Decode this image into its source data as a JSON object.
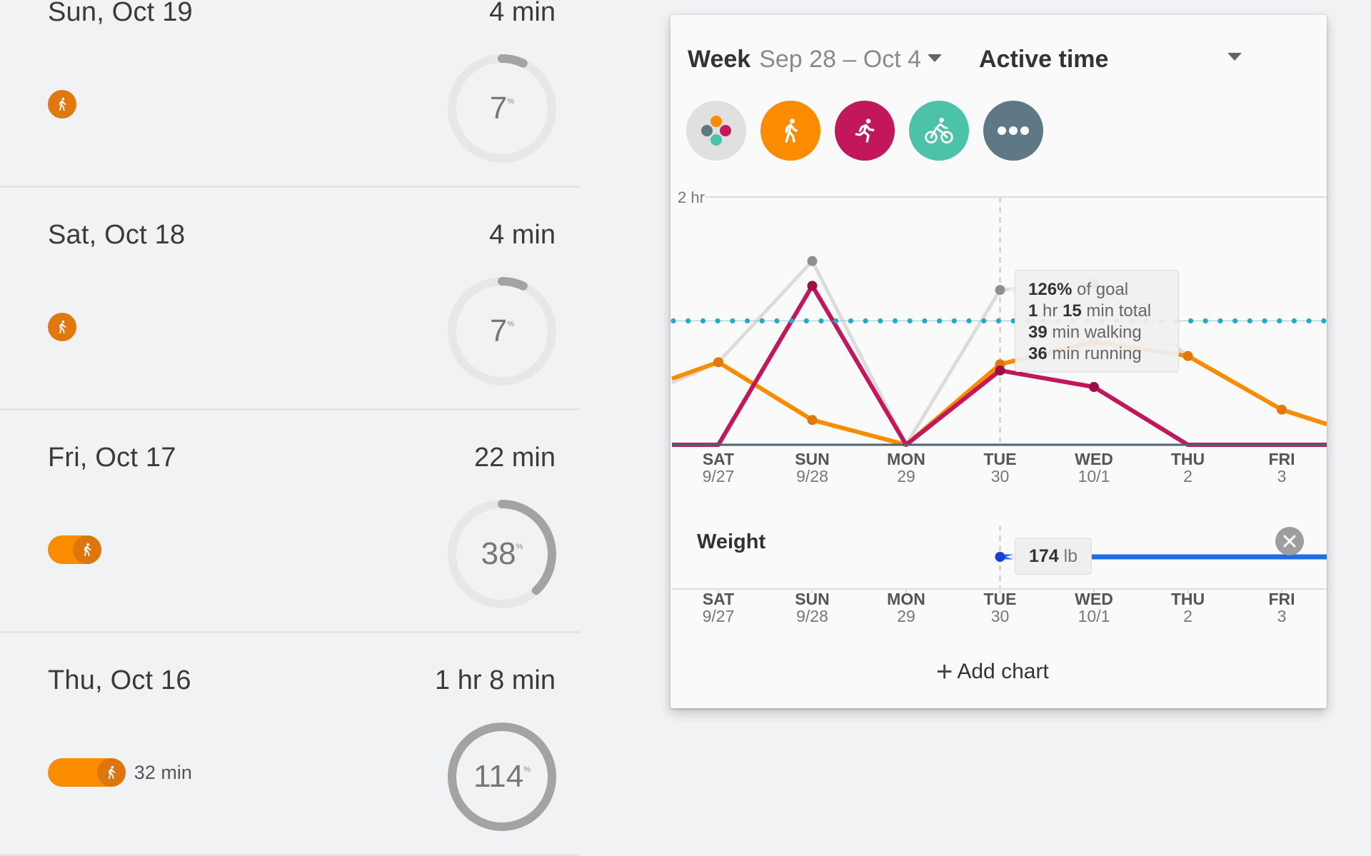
{
  "day_list": [
    {
      "date": "Sun, Oct 19",
      "total": "4 min",
      "goal_percent": 7,
      "ring_label": "7",
      "walk_minutes": 4,
      "walk_label": ""
    },
    {
      "date": "Sat, Oct 18",
      "total": "4 min",
      "goal_percent": 7,
      "ring_label": "7",
      "walk_minutes": 4,
      "walk_label": ""
    },
    {
      "date": "Fri, Oct 17",
      "total": "22 min",
      "goal_percent": 38,
      "ring_label": "38",
      "walk_minutes": 22,
      "walk_label": ""
    },
    {
      "date": "Thu, Oct 16",
      "total": "1 hr 8 min",
      "goal_percent": 114,
      "ring_label": "114",
      "walk_minutes": 32,
      "walk_label": "32 min"
    }
  ],
  "percent_sign": "%",
  "card": {
    "week_label": "Week",
    "week_range": "Sep 28 – Oct 4",
    "metric": "Active time",
    "filters": [
      {
        "name": "all-activities",
        "icon": "activity-mix-icon"
      },
      {
        "name": "walking",
        "icon": "walking-icon"
      },
      {
        "name": "running",
        "icon": "running-icon"
      },
      {
        "name": "biking",
        "icon": "biking-icon"
      },
      {
        "name": "more",
        "icon": "more-icon"
      }
    ],
    "tooltip": {
      "pct": "126%",
      "pct_suffix": " of goal",
      "hr": "1",
      "hr_unit": " hr ",
      "min": "15",
      "min_suffix": " min total",
      "walk": "39",
      "walk_suffix": " min walking",
      "run": "36",
      "run_suffix": " min running"
    },
    "weight": {
      "title": "Weight",
      "value": "174",
      "unit": " lb"
    },
    "add_chart_label": "Add chart",
    "colors": {
      "walking": "#fb8c00",
      "running": "#c2185b",
      "total": "#dcdcdc",
      "goal": "#26a9c4",
      "weight": "#1e6de8"
    }
  },
  "chart_data": [
    {
      "type": "line",
      "title": "Active time",
      "ylabel": "",
      "ylim": [
        0,
        120
      ],
      "y_ticks": [
        {
          "value": 120,
          "label": "2 hr"
        }
      ],
      "goal_minutes": 60,
      "categories": [
        "SAT",
        "SUN",
        "MON",
        "TUE",
        "WED",
        "THU",
        "FRI"
      ],
      "category_dates": [
        "9/27",
        "9/28",
        "29",
        "30",
        "10/1",
        "2",
        "3"
      ],
      "series": [
        {
          "name": "Total",
          "values": [
            40,
            89,
            0,
            75,
            78,
            43,
            17
          ],
          "edge_left": 30,
          "edge_right": 10
        },
        {
          "name": "Walking",
          "values": [
            40,
            12,
            0,
            39,
            50,
            43,
            17
          ],
          "edge_left": 32,
          "edge_right": 10
        },
        {
          "name": "Running",
          "values": [
            0,
            77,
            0,
            36,
            28,
            0,
            0
          ],
          "edge_left": 0,
          "edge_right": 0
        }
      ],
      "highlight_index": 3,
      "grid": true,
      "legend": "none"
    },
    {
      "type": "line",
      "title": "Weight",
      "categories": [
        "SAT",
        "SUN",
        "MON",
        "TUE",
        "WED",
        "THU",
        "FRI"
      ],
      "category_dates": [
        "9/27",
        "9/28",
        "29",
        "30",
        "10/1",
        "2",
        "3"
      ],
      "series": [
        {
          "name": "Weight (lb)",
          "values": [
            null,
            null,
            null,
            174,
            174,
            174,
            174
          ]
        }
      ],
      "highlight_index": 3
    }
  ]
}
